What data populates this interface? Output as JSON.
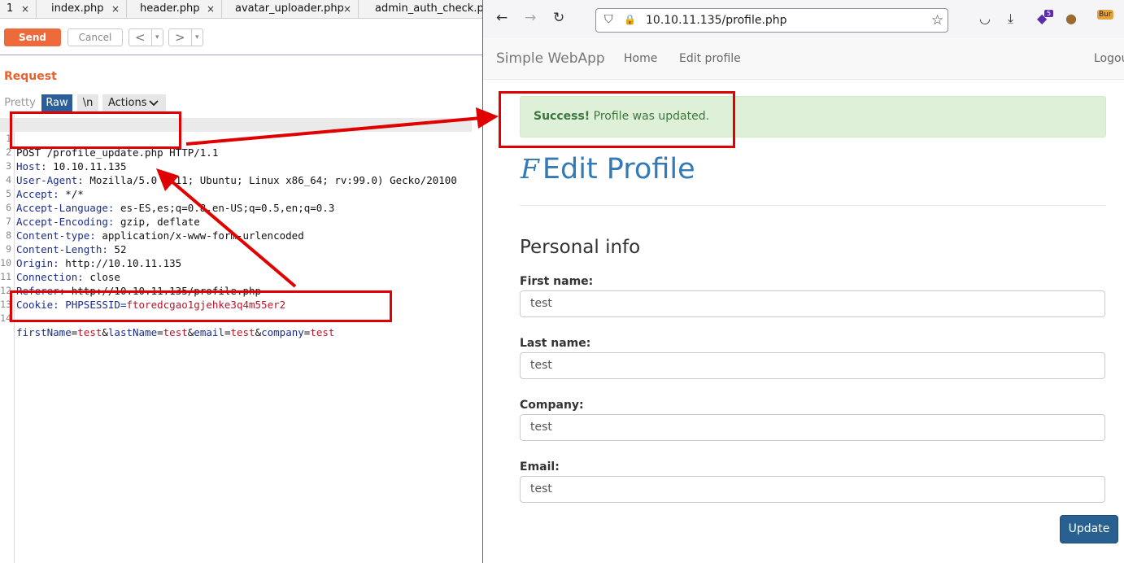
{
  "file_tabs": [
    "1",
    "index.php",
    "header.php",
    "avatar_uploader.php",
    "admin_auth_check.ph"
  ],
  "file_tab_close": "×",
  "toolbar": {
    "send": "Send",
    "cancel": "Cancel",
    "prev": "<",
    "next": ">",
    "dropdown": "▾"
  },
  "request": {
    "title": "Request",
    "view_tabs": {
      "pretty": "Pretty",
      "raw": "Raw",
      "newline": "\\n",
      "actions": "Actions"
    },
    "lines": [
      {
        "n": "1",
        "text": "POST /profile_update.php HTTP/1.1"
      },
      {
        "n": "2",
        "name": "Host:",
        "value": " 10.10.11.135"
      },
      {
        "n": "3",
        "name": "User-Agent:",
        "value": " Mozilla/5.0 (X11; Ubuntu; Linux x86_64; rv:99.0) Gecko/20100"
      },
      {
        "n": "4",
        "name": "Accept:",
        "value": " */*"
      },
      {
        "n": "5",
        "name": "Accept-Language:",
        "value": " es-ES,es;q=0.8,en-US;q=0.5,en;q=0.3"
      },
      {
        "n": "6",
        "name": "Accept-Encoding:",
        "value": " gzip, deflate"
      },
      {
        "n": "7",
        "name": "Content-type:",
        "value": " application/x-www-form-urlencoded"
      },
      {
        "n": "8",
        "name": "Content-Length:",
        "value": " 52"
      },
      {
        "n": "9",
        "name": "Origin:",
        "value": " http://10.10.11.135"
      },
      {
        "n": "10",
        "name": "Connection:",
        "value": " close"
      },
      {
        "n": "11",
        "name": "Referer:",
        "value": " http://10.10.11.135/profile.php"
      },
      {
        "n": "12",
        "name": "Cookie:",
        "value": " PHPSESSID=",
        "cookie": "ftoredcgao1gjehke3q4m55er2"
      },
      {
        "n": "13",
        "text": ""
      },
      {
        "n": "14",
        "body": [
          "firstName",
          "=",
          "test",
          "&",
          "lastName",
          "=",
          "test",
          "&",
          "email",
          "=",
          "test",
          "&",
          "company",
          "=",
          "test"
        ]
      }
    ]
  },
  "browser": {
    "url": "10.10.11.135/profile.php",
    "nav_icons": {
      "back": "←",
      "forward": "→",
      "reload": "↻",
      "shield": "⛉",
      "lock": "🔒",
      "star": "☆",
      "pocket": "◡",
      "download": "⤓",
      "ext1": "◆",
      "ext1_badge": "5",
      "ext2": "●",
      "ext3": "Bur"
    },
    "app": {
      "brand": "Simple WebApp",
      "home": "Home",
      "edit_profile": "Edit profile",
      "logout": "Logou"
    },
    "alert": {
      "strong": "Success!",
      "text": " Profile was updated."
    },
    "page_title_glyph": "F",
    "page_title": "Edit Profile",
    "section_title": "Personal info",
    "fields": [
      {
        "label": "First name:",
        "value": "test"
      },
      {
        "label": "Last name:",
        "value": "test"
      },
      {
        "label": "Company:",
        "value": "test"
      },
      {
        "label": "Email:",
        "value": "test"
      }
    ],
    "update_button": "Update"
  },
  "colors": {
    "annotation": "#e00000",
    "burp_accent": "#ef6a3a",
    "raw_tab": "#2c5f99",
    "link": "#337ab7",
    "success_bg": "#dff0d8"
  }
}
